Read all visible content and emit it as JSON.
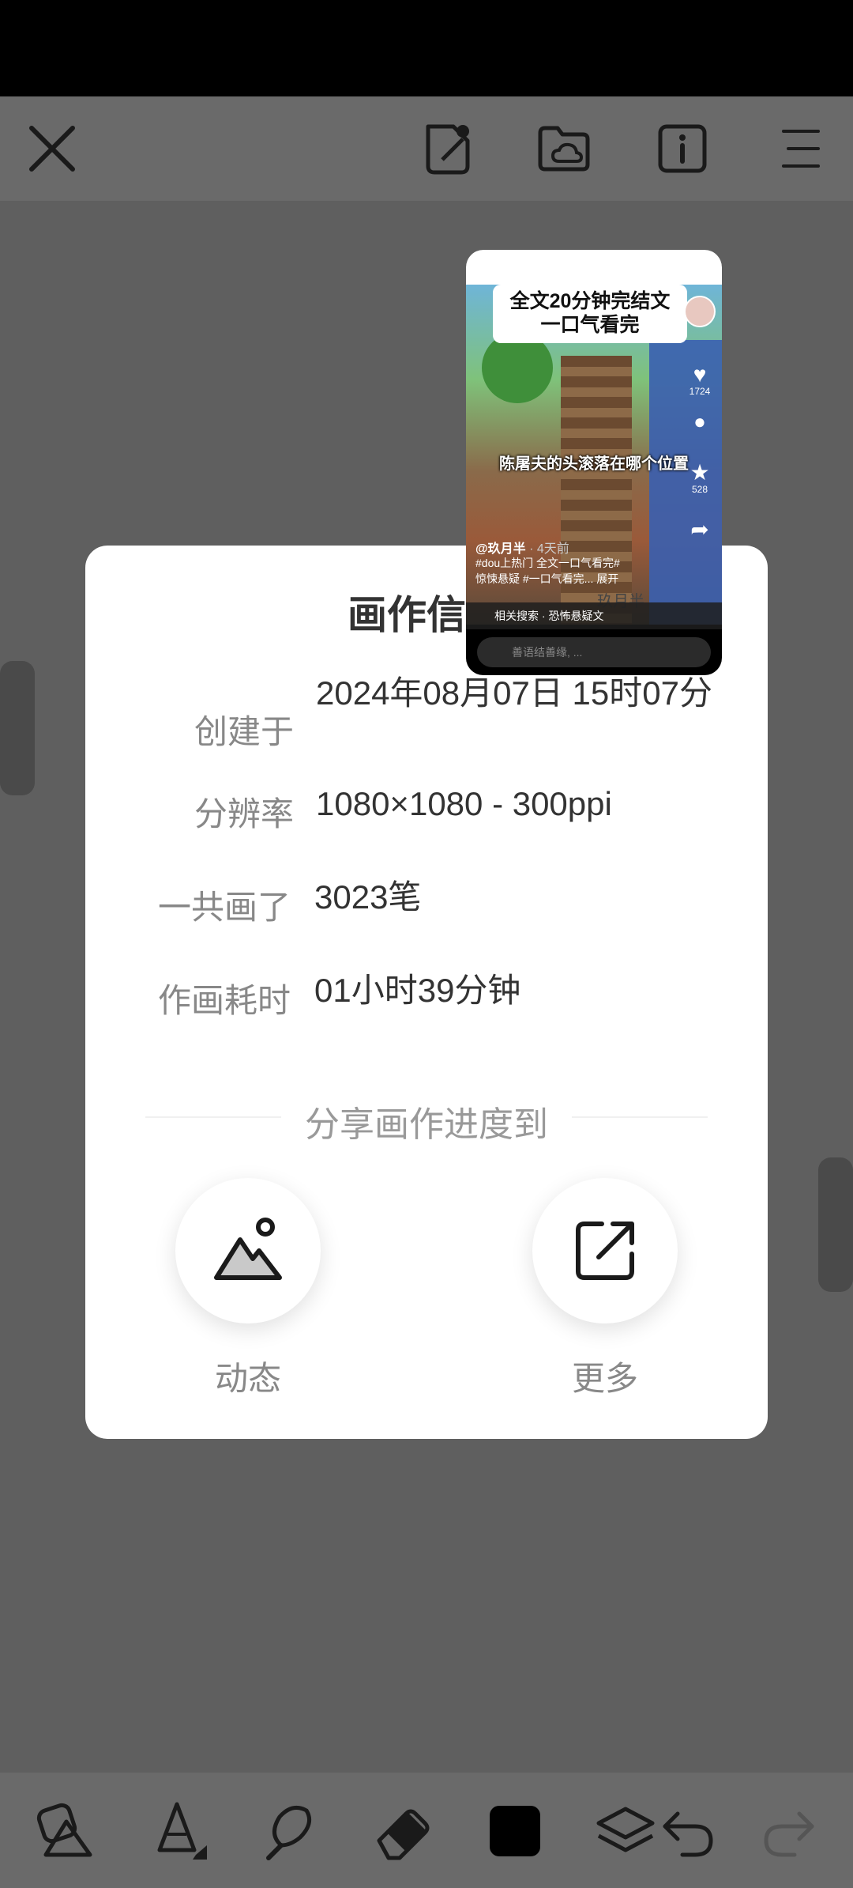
{
  "topbar": {
    "icons": [
      "close-icon",
      "sticker-icon",
      "folder-cloud-icon",
      "info-icon",
      "menu-icon"
    ]
  },
  "dialog": {
    "title": "画作信息",
    "rows": [
      {
        "label": "创建于",
        "value": "2024年08月07日 15时07分"
      },
      {
        "label": "分辨率",
        "value": "1080×1080 - 300ppi"
      },
      {
        "label": "一共画了",
        "value": "3023笔"
      },
      {
        "label": "作画耗时",
        "value": "01小时39分钟"
      }
    ],
    "share_label": "分享画作进度到",
    "share_options": [
      {
        "label": "动态",
        "icon": "mountain-image-icon"
      },
      {
        "label": "更多",
        "icon": "external-share-icon"
      }
    ]
  },
  "pip": {
    "caption_line1": "全文20分钟完结文",
    "caption_line2": "一口气看完",
    "subtitle": "陈屠夫的头滚落在哪个位置",
    "likes": "1724",
    "stars": "528",
    "author": "@玖月半",
    "time": "· 4天前",
    "tags_line1": "#dou上热门 全文一口气看完#",
    "tags_line2": "惊悚悬疑 #一口气看完...  展开",
    "watermark": "玖月半",
    "search": "相关搜索 · 恐怖悬疑文",
    "input_placeholder": "善语结善缘, ..."
  },
  "bottombar": {
    "tools": [
      "shape-icon",
      "pen-icon",
      "smudge-icon",
      "eraser-icon",
      "color-swatch-icon",
      "layers-icon",
      "undo-icon",
      "redo-icon"
    ]
  }
}
